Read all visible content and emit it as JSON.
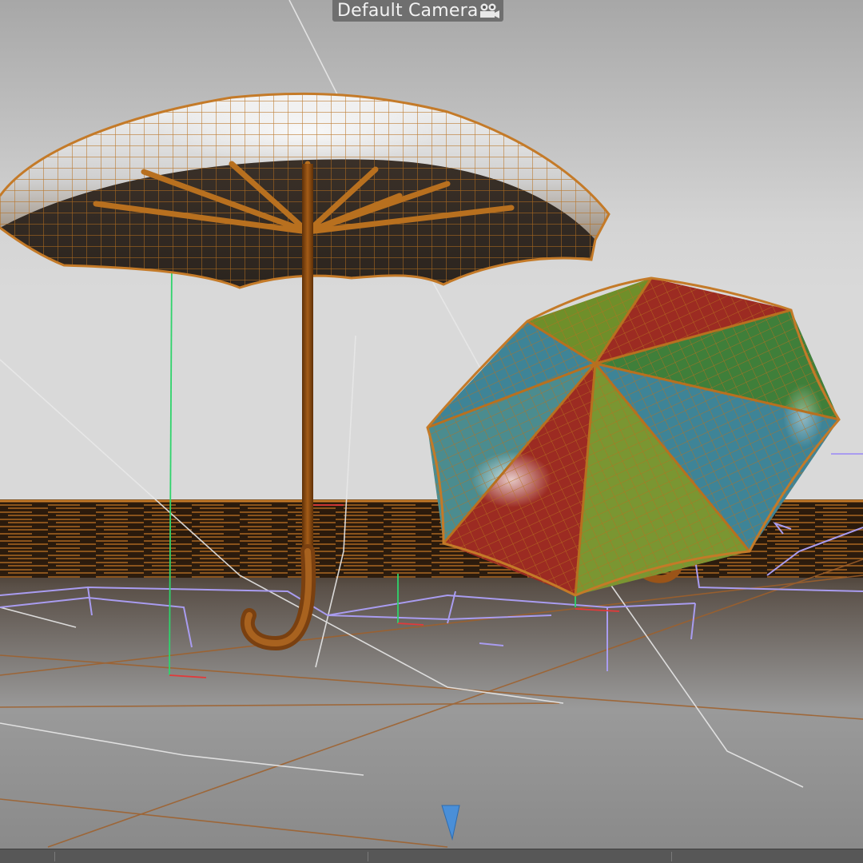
{
  "viewport": {
    "camera_label": "Default Camera",
    "camera_icon": "camera-icon"
  },
  "scene": {
    "objects": [
      "umbrella-open-brown",
      "umbrella-closed-multicolor"
    ],
    "floor": "wood-floor-wireframe",
    "colors": {
      "background_top": "#a9a9a9",
      "background_wall": "#d6d6d6",
      "floor_dark": "#2a1a0c",
      "wire_orange": "#b86e1e",
      "panel_green": "#6f8f2a",
      "panel_red": "#9c2b22",
      "panel_teal": "#3e8497",
      "handle_brown": "#8a4a12",
      "spline_purple": "#a99cf0",
      "axis_green": "#2fd36b"
    }
  },
  "statusbar": {
    "indicator_icon": "timeline-marker-icon"
  }
}
